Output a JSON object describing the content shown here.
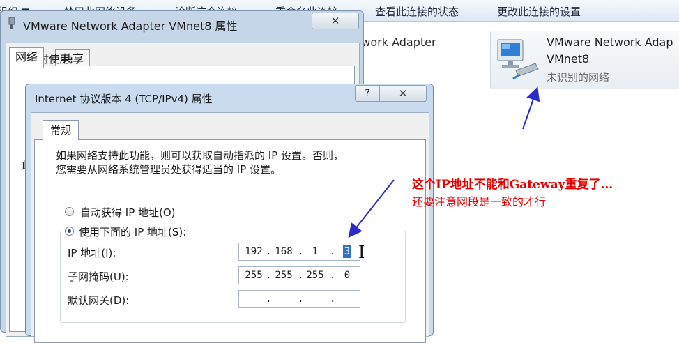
{
  "toolbar": {
    "organize": "组织 ▼",
    "disable": "禁用此网络设备",
    "diagnose": "诊断这个连接",
    "rename": "重命名此连接",
    "status": "查看此连接的状态",
    "change": "更改此连接的设置"
  },
  "content": {
    "partial_adapter_name": "twork Adapter",
    "card_name": "VMware Network Adap",
    "card_sub": "VMnet8",
    "card_status": "未识别的网络"
  },
  "dialog_adapter": {
    "title": "VMware Network Adapter VMnet8 属性",
    "close_glyph": "✕",
    "tabs": [
      "网络",
      "共享"
    ],
    "connect_label": "连接时使用:",
    "cut_text": "此"
  },
  "dialog_ipv4": {
    "title": "Internet 协议版本 4 (TCP/IPv4) 属性",
    "help_glyph": "?",
    "close_glyph": "✕",
    "tab": "常规",
    "desc_line1": "如果网络支持此功能，则可以获取自动指派的 IP 设置。否则，",
    "desc_line2": "您需要从网络系统管理员处获得适当的 IP 设置。",
    "radio_auto": "自动获得 IP 地址(O)",
    "radio_manual": "使用下面的 IP 地址(S):",
    "ip_label": "IP 地址(I):",
    "mask_label": "子网掩码(U):",
    "gateway_label": "默认网关(D):",
    "ip_octets": [
      "192",
      "168",
      "1",
      "3"
    ],
    "mask_octets": [
      "255",
      "255",
      "255",
      "0"
    ],
    "dot": "."
  },
  "annotation": {
    "line1": "这个IP地址不能和Gateway重复了...",
    "line2": "还要注意网段是一致的才行",
    "color": "#e60000",
    "arrow_color": "#2b2bc8"
  },
  "icons": {
    "network_adapter": "network-adapter-icon",
    "text_cursor": "I"
  }
}
